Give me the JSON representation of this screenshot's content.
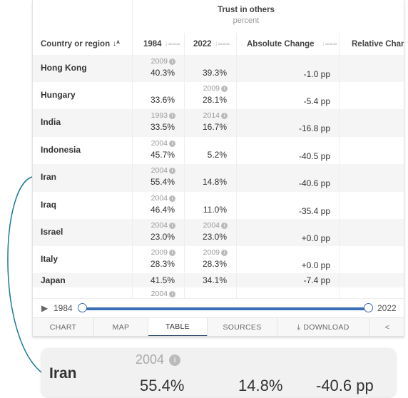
{
  "table": {
    "group_title": "Trust in others",
    "group_unit": "percent",
    "columns": [
      "Country or region",
      "1984",
      "2022",
      "Absolute Change",
      "Relative Change"
    ],
    "rows": [
      {
        "country": "Hong Kong",
        "start_note": "2009",
        "start": "40.3%",
        "end_note": "",
        "end": "39.3%",
        "abs": "-1.0 pp"
      },
      {
        "country": "Hungary",
        "start_note": "",
        "start": "33.6%",
        "end_note": "2009",
        "end": "28.1%",
        "abs": "-5.4 pp"
      },
      {
        "country": "India",
        "start_note": "1993",
        "start": "33.5%",
        "end_note": "2014",
        "end": "16.7%",
        "abs": "-16.8 pp"
      },
      {
        "country": "Indonesia",
        "start_note": "2004",
        "start": "45.7%",
        "end_note": "",
        "end": "5.2%",
        "abs": "-40.5 pp"
      },
      {
        "country": "Iran",
        "start_note": "2004",
        "start": "55.4%",
        "end_note": "",
        "end": "14.8%",
        "abs": "-40.6 pp"
      },
      {
        "country": "Iraq",
        "start_note": "2004",
        "start": "46.4%",
        "end_note": "",
        "end": "11.0%",
        "abs": "-35.4 pp"
      },
      {
        "country": "Israel",
        "start_note": "2004",
        "start": "23.0%",
        "end_note": "2004",
        "end": "23.0%",
        "abs": "+0.0 pp"
      },
      {
        "country": "Italy",
        "start_note": "2009",
        "start": "28.3%",
        "end_note": "2009",
        "end": "28.3%",
        "abs": "+0.0 pp"
      },
      {
        "country": "Japan",
        "start_note": "",
        "start": "41.5%",
        "end_note": "",
        "end": "34.1%",
        "abs": "-7.4 pp"
      },
      {
        "country": "",
        "start_note": "2004",
        "start": "",
        "end_note": "",
        "end": "",
        "abs": ""
      }
    ]
  },
  "timeline": {
    "start": "1984",
    "end": "2022",
    "accent": "#3a6db5"
  },
  "tabs": [
    "CHART",
    "MAP",
    "TABLE",
    "SOURCES",
    "DOWNLOAD"
  ],
  "active_tab": "TABLE",
  "callout": {
    "country": "Iran",
    "note": "2004",
    "start": "55.4%",
    "end": "14.8%",
    "abs": "-40.6 pp",
    "connector_color": "#1a7a9a"
  }
}
